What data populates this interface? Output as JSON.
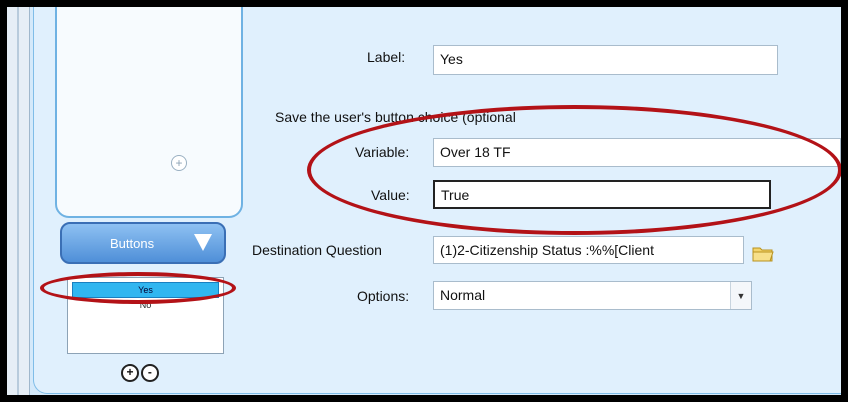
{
  "sidebar": {
    "add_label": "+",
    "section_title": "Buttons",
    "items": [
      {
        "label": "Yes",
        "selected": true
      },
      {
        "label": "No",
        "selected": false
      }
    ],
    "add_button": "+",
    "remove_button": "-"
  },
  "form": {
    "label_caption": "Label:",
    "label_value": "Yes",
    "save_caption": "Save the user's button choice (optional",
    "variable_caption": "Variable:",
    "variable_value": "Over 18 TF",
    "value_caption": "Value:",
    "value_value": "True",
    "destination_caption": "Destination Question",
    "destination_value": "(1)2-Citizenship Status :%%[Client",
    "options_caption": "Options:",
    "options_value": "Normal"
  },
  "colors": {
    "highlight": "#b31217",
    "accent": "#4f8fd8",
    "selected_item": "#31b6f0"
  }
}
